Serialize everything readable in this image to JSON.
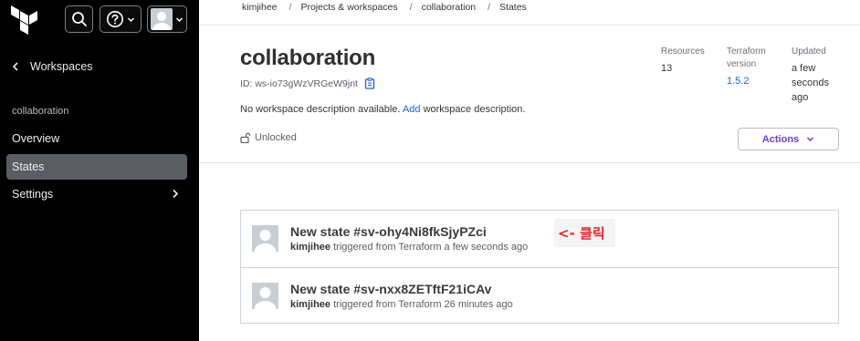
{
  "sidebar": {
    "back_label": "Workspaces",
    "section_label": "collaboration",
    "items": [
      {
        "label": "Overview",
        "active": false
      },
      {
        "label": "States",
        "active": true
      },
      {
        "label": "Settings",
        "active": false,
        "has_submenu": true
      }
    ],
    "icons": [
      "terraform-logo",
      "search-icon",
      "help-icon",
      "user-avatar-icon"
    ]
  },
  "breadcrumb": [
    "kimjihee",
    "Projects & workspaces",
    "collaboration",
    "States"
  ],
  "workspace": {
    "name": "collaboration",
    "id_label": "ID: ws-io73gWzVRGeW9jnt",
    "description_prefix": "No workspace description available.",
    "description_link": "Add",
    "description_suffix": "workspace description.",
    "lock_status": "Unlocked"
  },
  "meta": {
    "resources_label": "Resources",
    "resources_value": "13",
    "version_label": "Terraform version",
    "version_value": "1.5.2",
    "updated_label": "Updated",
    "updated_value": "a few seconds ago"
  },
  "actions_label": "Actions",
  "states": [
    {
      "title": "New state #sv-ohy4Ni8fkSjyPZci",
      "user": "kimjihee",
      "detail": "triggered from Terraform a few seconds ago"
    },
    {
      "title": "New state #sv-nxx8ZETftF21iCAv",
      "user": "kimjihee",
      "detail": "triggered from Terraform 26 minutes ago"
    }
  ],
  "annotation_text": "<- 클릭",
  "colors": {
    "sidebar_bg": "#000000",
    "active_nav": "#5a5d62",
    "link": "#1f62e0",
    "actions": "#6c3dd1",
    "annotation": "#e8262a"
  }
}
